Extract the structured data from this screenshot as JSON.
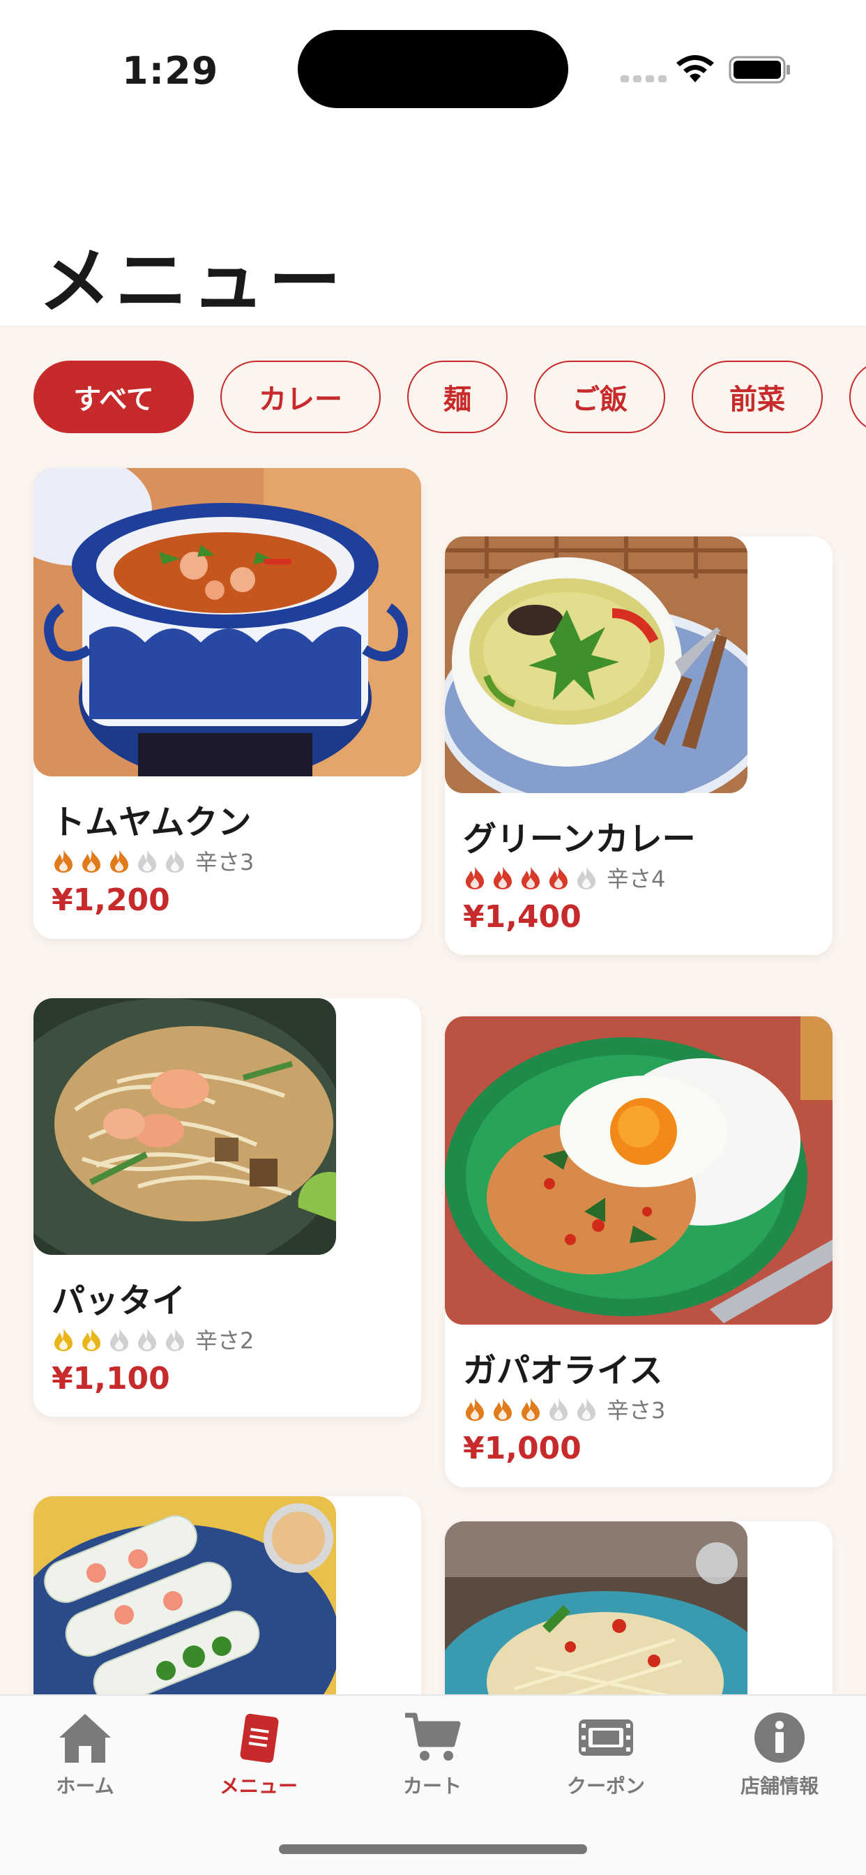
{
  "status_bar": {
    "time": "1:29"
  },
  "header": {
    "title": "メニュー"
  },
  "categories": {
    "items": [
      {
        "label": "すべて",
        "active": true
      },
      {
        "label": "カレー"
      },
      {
        "label": "麺"
      },
      {
        "label": "ご飯"
      },
      {
        "label": "前菜"
      }
    ]
  },
  "menu": {
    "items": [
      {
        "name": "トムヤムクン",
        "spice_level": 3,
        "spice_max": 5,
        "spice_label": "辛さ3",
        "price": "¥1,200",
        "flame_color": "#e07a1a",
        "image": "tom-yum-soup"
      },
      {
        "name": "グリーンカレー",
        "spice_level": 4,
        "spice_max": 5,
        "spice_label": "辛さ4",
        "price": "¥1,400",
        "flame_color": "#d83a2a",
        "image": "green-curry"
      },
      {
        "name": "パッタイ",
        "spice_level": 2,
        "spice_max": 5,
        "spice_label": "辛さ2",
        "price": "¥1,100",
        "flame_color": "#e8b51a",
        "image": "pad-thai"
      },
      {
        "name": "ガパオライス",
        "spice_level": 3,
        "spice_max": 5,
        "spice_label": "辛さ3",
        "price": "¥1,000",
        "flame_color": "#e07a1a",
        "image": "gapao-rice"
      },
      {
        "image": "spring-rolls"
      },
      {
        "image": "papaya-salad"
      }
    ]
  },
  "tab_bar": {
    "tabs": [
      {
        "label": "ホーム",
        "icon": "home-icon"
      },
      {
        "label": "メニュー",
        "icon": "menu-book-icon",
        "active": true
      },
      {
        "label": "カート",
        "icon": "cart-icon"
      },
      {
        "label": "クーポン",
        "icon": "coupon-icon"
      },
      {
        "label": "店舗情報",
        "icon": "info-icon"
      }
    ]
  },
  "colors": {
    "accent": "#c62a2a",
    "background": "#fcf4ef",
    "inactive_flame": "#d0d0d0"
  }
}
